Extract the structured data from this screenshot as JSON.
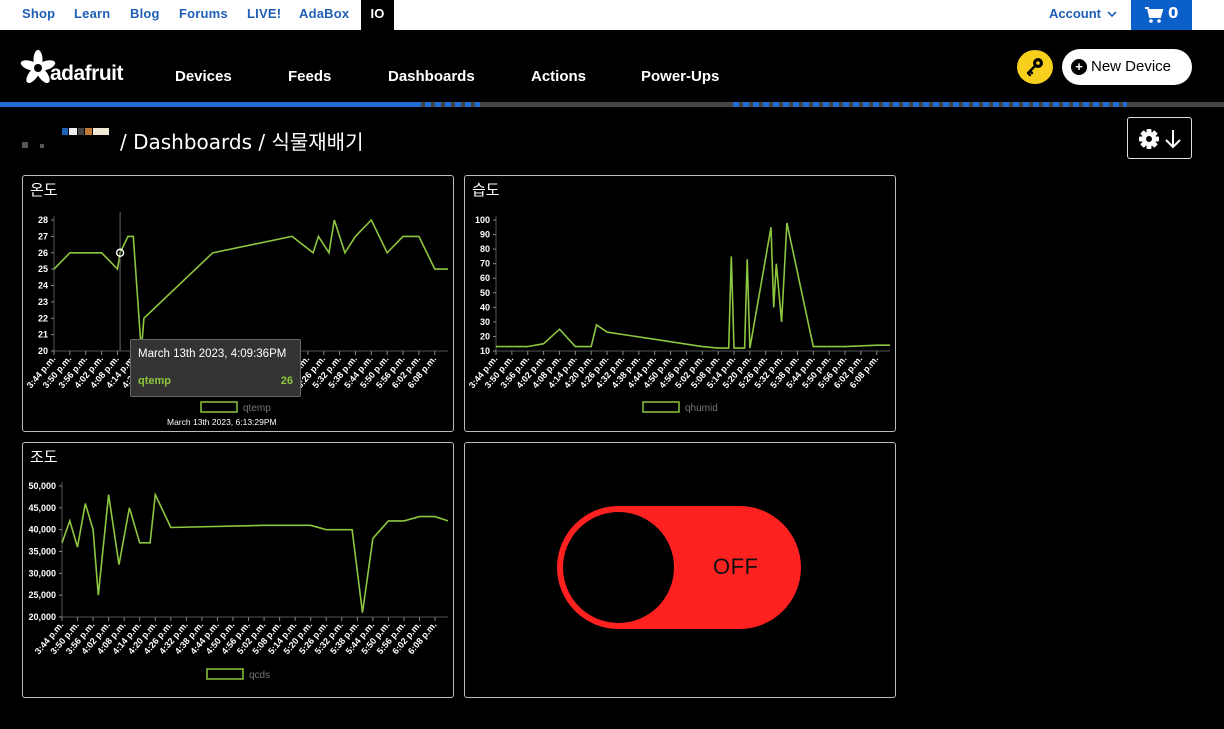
{
  "topbar": {
    "links": [
      "Shop",
      "Learn",
      "Blog",
      "Forums",
      "LIVE!",
      "AdaBox",
      "IO"
    ],
    "account_label": "Account",
    "cart_count": "0"
  },
  "nav": {
    "logo_text": "adafruit",
    "items": [
      "Devices",
      "Feeds",
      "Dashboards",
      "Actions",
      "Power-Ups"
    ],
    "new_device_label": "New Device"
  },
  "breadcrumb": {
    "text": "/ Dashboards / 식물재배기"
  },
  "colors": {
    "accent": "#8dc63f",
    "brand_blue": "#1f5fb5",
    "toggle_off": "#ff2020",
    "key_yellow": "#f7cf1d"
  },
  "icons": [
    "adafruit-star-icon",
    "cart-icon",
    "key-icon",
    "plus-icon",
    "gear-icon",
    "arrow-down-icon",
    "chevron-down-icon"
  ],
  "time_ticks": [
    "3:44 p.m.",
    "3:50 p.m.",
    "3:56 p.m.",
    "4:02 p.m.",
    "4:08 p.m.",
    "4:14 p.m.",
    "4:20 p.m.",
    "4:26 p.m.",
    "4:32 p.m.",
    "4:38 p.m.",
    "4:44 p.m.",
    "4:50 p.m.",
    "4:56 p.m.",
    "5:02 p.m.",
    "5:08 p.m.",
    "5:14 p.m.",
    "5:20 p.m.",
    "5:26 p.m.",
    "5:32 p.m.",
    "5:38 p.m.",
    "5:44 p.m.",
    "5:50 p.m.",
    "5:56 p.m.",
    "6:02 p.m.",
    "6:08 p.m."
  ],
  "panels": {
    "temp": {
      "title": "온도",
      "tooltip": {
        "title": "March 13th 2023, 4:09:36PM",
        "series": "qtemp",
        "value": "26"
      },
      "updated": "March 13th 2023, 6:13:29PM"
    },
    "humid": {
      "title": "습도"
    },
    "light": {
      "title": "조도"
    },
    "switch": {
      "state": "OFF"
    }
  },
  "chart_data": [
    {
      "type": "line",
      "title": "온도",
      "series": [
        {
          "name": "qtemp",
          "x": [
            "3:44 p.m.",
            "3:50 p.m.",
            "3:56 p.m.",
            "4:02 p.m.",
            "4:08 p.m.",
            "4:09 p.m.",
            "4:12 p.m.",
            "4:14 p.m.",
            "4:17 p.m.",
            "4:18 p.m.",
            "4:44 p.m.",
            "5:14 p.m.",
            "5:22 p.m.",
            "5:24 p.m.",
            "5:28 p.m.",
            "5:30 p.m.",
            "5:34 p.m.",
            "5:38 p.m.",
            "5:44 p.m.",
            "5:50 p.m.",
            "5:56 p.m.",
            "6:02 p.m.",
            "6:08 p.m.",
            "6:13 p.m."
          ],
          "values": [
            25,
            26,
            26,
            26,
            25,
            26,
            27,
            27,
            20,
            22,
            26,
            27,
            26,
            27,
            26,
            28,
            26,
            27,
            28,
            26,
            27,
            27,
            25,
            25
          ]
        }
      ],
      "ylim": [
        20,
        28
      ],
      "yticks": [
        "20",
        "21",
        "22",
        "23",
        "24",
        "25",
        "26",
        "27",
        "28"
      ],
      "legend": "bottom"
    },
    {
      "type": "line",
      "title": "습도",
      "series": [
        {
          "name": "qhumid",
          "x": [
            "3:44 p.m.",
            "3:56 p.m.",
            "4:02 p.m.",
            "4:08 p.m.",
            "4:14 p.m.",
            "4:20 p.m.",
            "4:22 p.m.",
            "4:26 p.m.",
            "5:02 p.m.",
            "5:08 p.m.",
            "5:12 p.m.",
            "5:13 p.m.",
            "5:14 p.m.",
            "5:18 p.m.",
            "5:19 p.m.",
            "5:20 p.m.",
            "5:28 p.m.",
            "5:29 p.m.",
            "5:30 p.m.",
            "5:32 p.m.",
            "5:34 p.m.",
            "5:42 p.m.",
            "5:44 p.m.",
            "5:56 p.m.",
            "6:08 p.m.",
            "6:13 p.m."
          ],
          "values": [
            13,
            13,
            15,
            25,
            13,
            13,
            28,
            23,
            13,
            12,
            12,
            75,
            12,
            12,
            73,
            12,
            95,
            40,
            70,
            30,
            98,
            30,
            13,
            13,
            14,
            14
          ]
        }
      ],
      "ylim": [
        10,
        100
      ],
      "yticks": [
        "10",
        "20",
        "30",
        "40",
        "50",
        "60",
        "70",
        "80",
        "90",
        "100"
      ],
      "legend": "bottom"
    },
    {
      "type": "line",
      "title": "조도",
      "series": [
        {
          "name": "qcds",
          "x": [
            "3:44 p.m.",
            "3:47 p.m.",
            "3:50 p.m.",
            "3:53 p.m.",
            "3:56 p.m.",
            "3:58 p.m.",
            "4:02 p.m.",
            "4:06 p.m.",
            "4:10 p.m.",
            "4:14 p.m.",
            "4:18 p.m.",
            "4:20 p.m.",
            "4:26 p.m.",
            "5:02 p.m.",
            "5:08 p.m.",
            "5:20 p.m.",
            "5:26 p.m.",
            "5:36 p.m.",
            "5:40 p.m.",
            "5:44 p.m.",
            "5:50 p.m.",
            "5:56 p.m.",
            "6:02 p.m.",
            "6:08 p.m.",
            "6:13 p.m."
          ],
          "values": [
            37000,
            42000,
            36000,
            46000,
            40000,
            25000,
            48000,
            32000,
            45000,
            37000,
            37000,
            48000,
            40500,
            41000,
            41000,
            41000,
            40000,
            40000,
            21000,
            38000,
            42000,
            42000,
            43000,
            43000,
            42000
          ]
        }
      ],
      "ylim": [
        20000,
        50000
      ],
      "yticks": [
        "20,000",
        "25,000",
        "30,000",
        "35,000",
        "40,000",
        "45,000",
        "50,000"
      ],
      "legend": "bottom"
    }
  ]
}
